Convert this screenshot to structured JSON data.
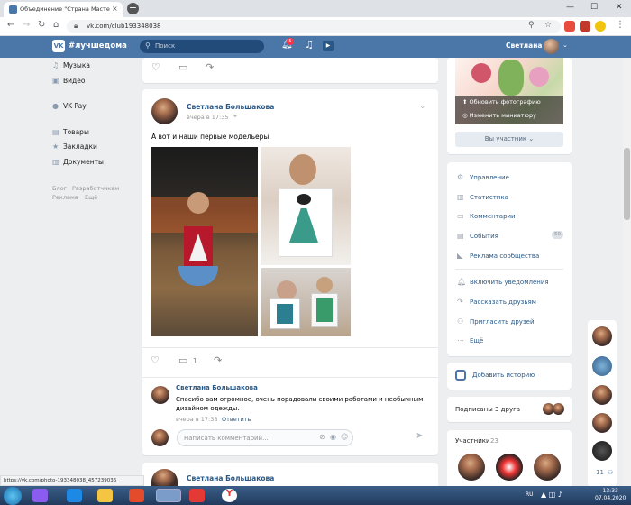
{
  "browser": {
    "tab_title": "Объединение \"Страна Мастер",
    "tab_close": "×",
    "new_tab": "+",
    "url": "vk.com/club193348038",
    "window_controls": {
      "minimize": "—",
      "maximize": "☐",
      "close": "✕"
    }
  },
  "vk_header": {
    "logo": "VK",
    "title": "#лучшедома",
    "search_placeholder": "Поиск",
    "notifications_count": "5",
    "user_name": "Светлана"
  },
  "left_menu": {
    "items": [
      {
        "label": "Музыка",
        "icon": "music-icon"
      },
      {
        "label": "Видео",
        "icon": "video-icon"
      },
      {
        "label": "VK Pay",
        "icon": "vkpay-icon"
      },
      {
        "label": "Товары",
        "icon": "goods-icon"
      },
      {
        "label": "Закладки",
        "icon": "bookmark-icon"
      },
      {
        "label": "Документы",
        "icon": "document-icon"
      }
    ],
    "footer": [
      "Блог",
      "Разработчикам",
      "Реклама",
      "Ещё"
    ]
  },
  "post": {
    "author": "Светлана Большакова",
    "time": "вчера в 17:35",
    "text": "А вот и наши первые модельеры",
    "comments_count": "1"
  },
  "comment": {
    "author": "Светлана Большакова",
    "text": "Спасибо вам огромное, очень порадовали своими работами и необычным дизайном одежды.",
    "time": "вчера в 17:33",
    "reply": "Ответить"
  },
  "comment_input": {
    "placeholder": "Написать комментарий..."
  },
  "next_post": {
    "author": "Светлана Большакова"
  },
  "right_panel": {
    "update_photo": "Обновить фотографию",
    "change_thumbnail": "Изменить миниатюру",
    "member_button": "Вы участник ⌄",
    "menu": [
      {
        "label": "Управление",
        "icon": "gear-icon"
      },
      {
        "label": "Статистика",
        "icon": "stats-icon"
      },
      {
        "label": "Комментарии",
        "icon": "comment-icon"
      },
      {
        "label": "События",
        "icon": "events-icon"
      },
      {
        "label": "Реклама сообщества",
        "icon": "megaphone-icon"
      },
      {
        "label": "Включить уведомления",
        "icon": "bell-icon"
      },
      {
        "label": "Рассказать друзьям",
        "icon": "share-icon"
      },
      {
        "label": "Пригласить друзей",
        "icon": "invite-icon"
      },
      {
        "label": "Ещё",
        "icon": "more-icon"
      }
    ],
    "events_count": "50",
    "add_story": "Добавить историю",
    "subscribed": "Подписаны 3 друга",
    "members_label": "Участники",
    "members_count": "23"
  },
  "side_chat_count": "11",
  "statusbar_url": "https://vk.com/photo-193348038_457239036",
  "taskbar": {
    "lang": "RU",
    "time": "13:33",
    "date": "07.04.2020"
  }
}
